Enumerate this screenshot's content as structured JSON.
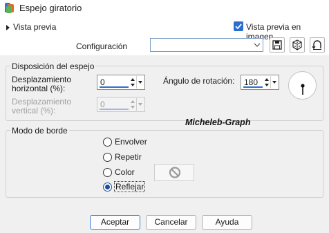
{
  "window": {
    "title": "Espejo giratorio"
  },
  "preview": {
    "toggle_label": "Vista previa",
    "image_preview_label": "Vista previa en imagen",
    "image_preview_checked": true
  },
  "config": {
    "label": "Configuración",
    "value": ""
  },
  "mirror_layout": {
    "legend": "Disposición del espejo",
    "hoffset_label_1": "Desplazamiento",
    "hoffset_label_2": "horizontal (%):",
    "hoffset_value": "0",
    "voffset_label_1": "Desplazamiento",
    "voffset_label_2": "vertical (%):",
    "voffset_value": "0",
    "angle_label": "Ángulo de rotación:",
    "angle_value": "180"
  },
  "watermark": "Micheleb-Graph",
  "border_mode": {
    "legend": "Modo de borde",
    "options": [
      "Envolver",
      "Repetir",
      "Color",
      "Reflejar"
    ],
    "selected": "Reflejar"
  },
  "buttons": {
    "ok": "Aceptar",
    "cancel": "Cancelar",
    "help": "Ayuda"
  },
  "colors": {
    "accent": "#2b6fce",
    "radio_selected": "#1d4f99"
  }
}
